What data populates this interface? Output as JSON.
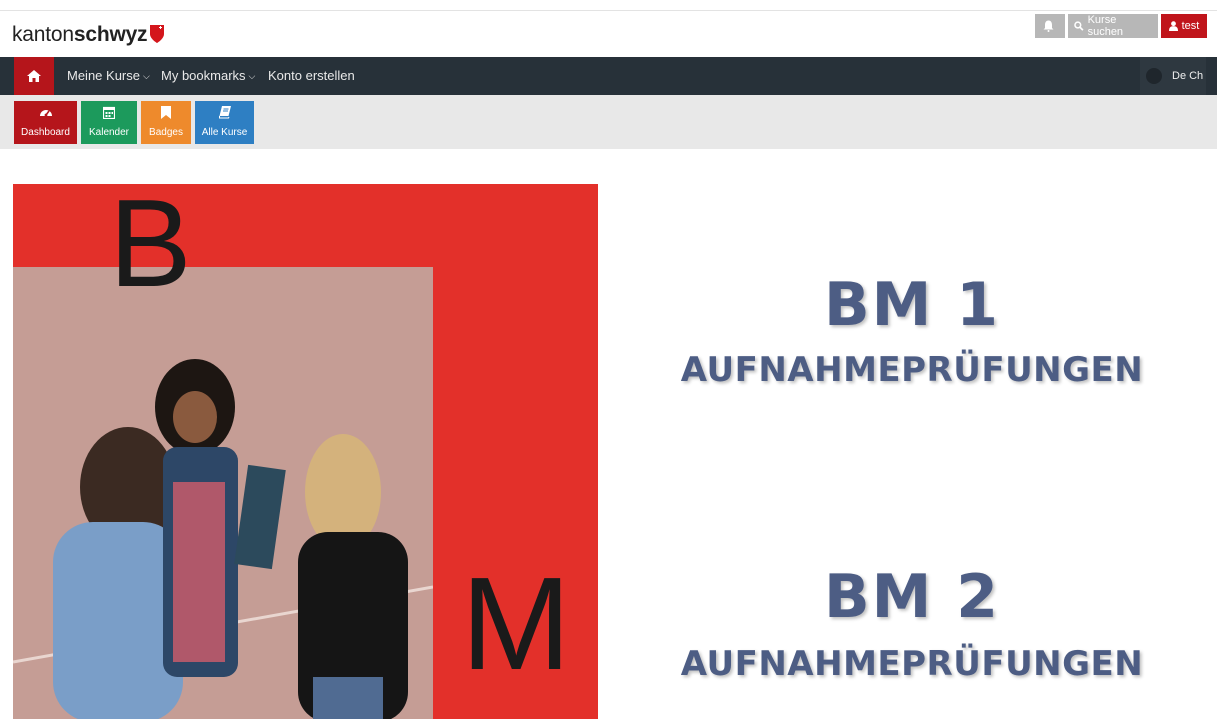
{
  "logo": {
    "light": "kanton",
    "bold": "schwyz"
  },
  "header": {
    "search_label": "Kurse suchen",
    "user_label": "test"
  },
  "nav": {
    "items": [
      {
        "label": "Meine Kurse",
        "has_dropdown": true
      },
      {
        "label": "My bookmarks",
        "has_dropdown": true
      },
      {
        "label": "Konto erstellen",
        "has_dropdown": false
      }
    ],
    "lang_label": "De Ch"
  },
  "quick": [
    {
      "label": "Dashboard",
      "icon": "dashboard-icon",
      "color": "#b5151b"
    },
    {
      "label": "Kalender",
      "icon": "calendar-icon",
      "color": "#1c9a5c"
    },
    {
      "label": "Badges",
      "icon": "bookmark-icon",
      "color": "#ee8a2c"
    },
    {
      "label": "Alle Kurse",
      "icon": "book-icon",
      "color": "#2e7fc3"
    }
  ],
  "hero": {
    "letter_top": "B",
    "letter_bottom": "M"
  },
  "courses": [
    {
      "title": "BM 1",
      "subtitle": "AUFNAHMEPRÜFUNGEN"
    },
    {
      "title": "BM 2",
      "subtitle": "AUFNAHMEPRÜFUNGEN"
    }
  ],
  "colors": {
    "brand_red": "#b5151b",
    "nav_dark": "#273139",
    "title_blue": "#4d5d84",
    "hero_red": "#e3302a"
  }
}
